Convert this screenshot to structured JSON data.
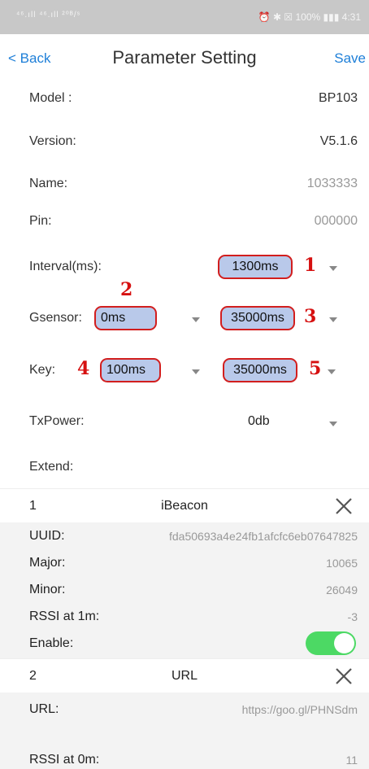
{
  "status": {
    "left": "⁴⁶.ıll ⁴⁶.ıll ²⁰ᴮ/ˢ",
    "right": "⏰ ✱ ☒ 100% ▮▮▮ 4:31"
  },
  "nav": {
    "back": "< Back",
    "title": "Parameter Setting",
    "save": "Save"
  },
  "fields": {
    "model": {
      "label": "Model :",
      "value": "BP103"
    },
    "version": {
      "label": "Version:",
      "value": "V5.1.6"
    },
    "name": {
      "label": "Name:",
      "value": "1033333"
    },
    "pin": {
      "label": "Pin:",
      "value": "000000"
    },
    "interval": {
      "label": "Interval(ms):",
      "value": "1300ms",
      "marker": "1"
    },
    "gsensor": {
      "label": "Gsensor:",
      "value1": "0ms",
      "marker1": "2",
      "value2": "35000ms",
      "marker2": "3"
    },
    "key": {
      "label": "Key:",
      "value1": "100ms",
      "marker1": "4",
      "value2": "35000ms",
      "marker2": "5"
    },
    "txpower": {
      "label": "TxPower:",
      "value": "0db"
    },
    "extend": {
      "label": "Extend:"
    }
  },
  "slot1": {
    "index": "1",
    "type": "iBeacon",
    "rows": [
      {
        "k": "UUID:",
        "v": "fda50693a4e24fb1afcfc6eb07647825"
      },
      {
        "k": "Major:",
        "v": "10065"
      },
      {
        "k": "Minor:",
        "v": "26049"
      },
      {
        "k": "RSSI at 1m:",
        "v": "-3"
      },
      {
        "k": "Enable:",
        "v": ""
      }
    ],
    "enabled": true
  },
  "slot2": {
    "index": "2",
    "type": "URL",
    "rows": [
      {
        "k": "URL:",
        "v": "https://goo.gl/PHNSdm"
      },
      {
        "k": "RSSI at 0m:",
        "v": "11"
      }
    ]
  },
  "colors": {
    "accent": "#1e7fd8",
    "highlight_fill": "#b9c9ea",
    "highlight_border": "#d21e1e",
    "toggle_on": "#4cd964"
  }
}
